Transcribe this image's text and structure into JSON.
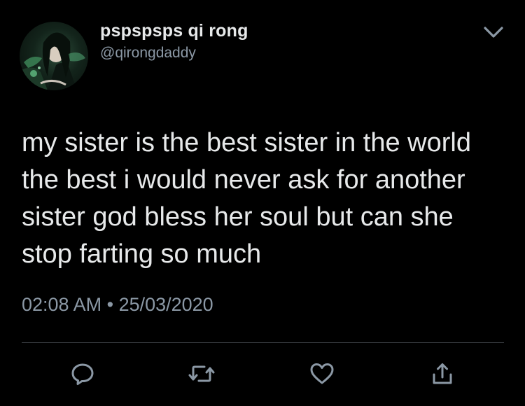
{
  "tweet": {
    "display_name": "pspspsps qi rong",
    "handle": "@qirongdaddy",
    "text": "my sister is the best sister in the world the best i would never ask for another sister god bless her soul but can she stop farting so much",
    "time": "02:08 AM",
    "separator": "•",
    "date": "25/03/2020"
  },
  "icons": {
    "menu": "chevron-down-icon",
    "reply": "reply-icon",
    "retweet": "retweet-icon",
    "like": "heart-icon",
    "share": "share-icon"
  },
  "colors": {
    "background": "#000000",
    "primary_text": "#e7e9ea",
    "secondary_text": "#8b98a5",
    "divider": "#3a3f44"
  }
}
